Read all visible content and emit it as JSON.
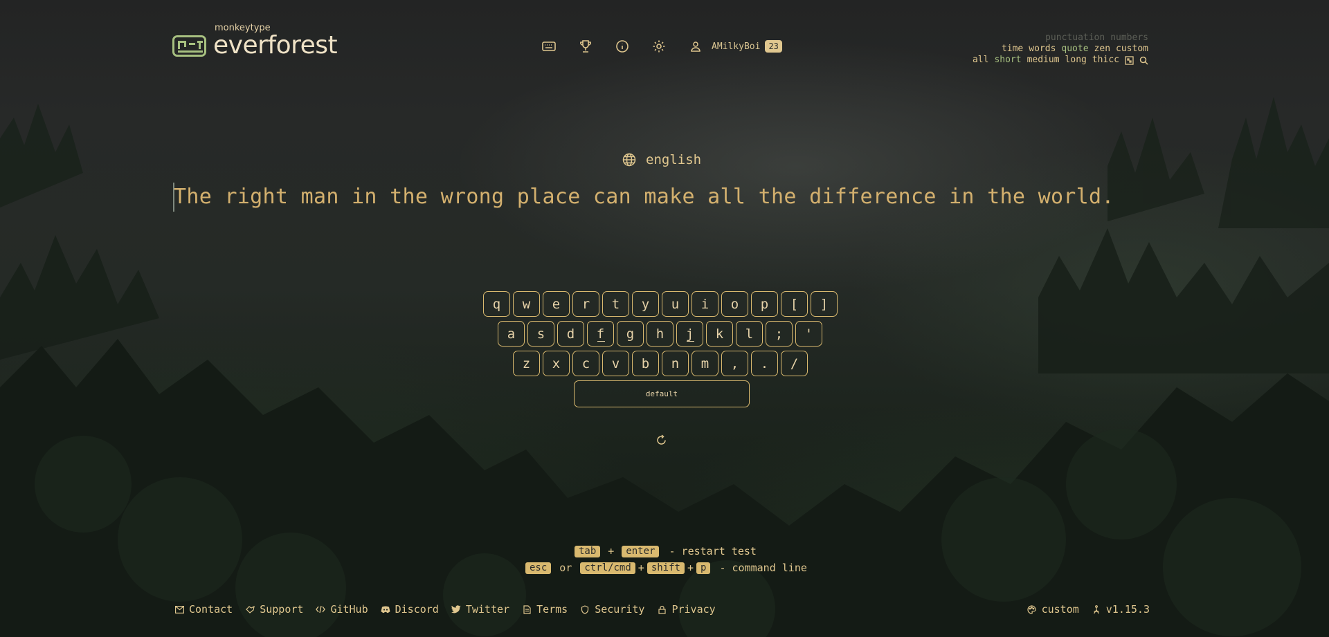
{
  "brand": {
    "top": "monkeytype",
    "main": "everforest"
  },
  "nav": {
    "items": [
      {
        "name": "keyboard-icon"
      },
      {
        "name": "trophy-icon"
      },
      {
        "name": "info-icon"
      },
      {
        "name": "gear-icon"
      }
    ],
    "username": "AMilkyBoi",
    "level": "23"
  },
  "config": {
    "row1": [
      {
        "label": "punctuation",
        "state": "dim"
      },
      {
        "label": "numbers",
        "state": "dim"
      }
    ],
    "row2": [
      {
        "label": "time",
        "state": "normal"
      },
      {
        "label": "words",
        "state": "normal"
      },
      {
        "label": "quote",
        "state": "active"
      },
      {
        "label": "zen",
        "state": "normal"
      },
      {
        "label": "custom",
        "state": "normal"
      }
    ],
    "row3": [
      {
        "label": "all",
        "state": "normal"
      },
      {
        "label": "short",
        "state": "active"
      },
      {
        "label": "medium",
        "state": "normal"
      },
      {
        "label": "long",
        "state": "normal"
      },
      {
        "label": "thicc",
        "state": "normal"
      }
    ]
  },
  "test": {
    "language": "english",
    "quote": "The right man in the wrong place can make all the difference in the world."
  },
  "keymap": {
    "row1": [
      "q",
      "w",
      "e",
      "r",
      "t",
      "y",
      "u",
      "i",
      "o",
      "p",
      "[",
      "]"
    ],
    "row2": [
      "a",
      "s",
      "d",
      "f",
      "g",
      "h",
      "j",
      "k",
      "l",
      ";",
      "'"
    ],
    "row3": [
      "z",
      "x",
      "c",
      "v",
      "b",
      "n",
      "m",
      ",",
      ".",
      "/"
    ],
    "space_label": "default"
  },
  "hints": {
    "restart": {
      "k1": "tab",
      "plus": "+",
      "k2": "enter",
      "text": "- restart test"
    },
    "command": {
      "k1": "esc",
      "or": "or",
      "k2": "ctrl/cmd",
      "plus1": "+",
      "k3": "shift",
      "plus2": "+",
      "k4": "p",
      "text": "- command line"
    }
  },
  "footer": {
    "links": [
      "Contact",
      "Support",
      "GitHub",
      "Discord",
      "Twitter",
      "Terms",
      "Security",
      "Privacy"
    ],
    "theme": "custom",
    "version": "v1.15.3"
  },
  "colors": {
    "accent": "#e0c78f",
    "active": "#a7c080",
    "dim": "#5c5f57",
    "text": "#d3b06e"
  }
}
